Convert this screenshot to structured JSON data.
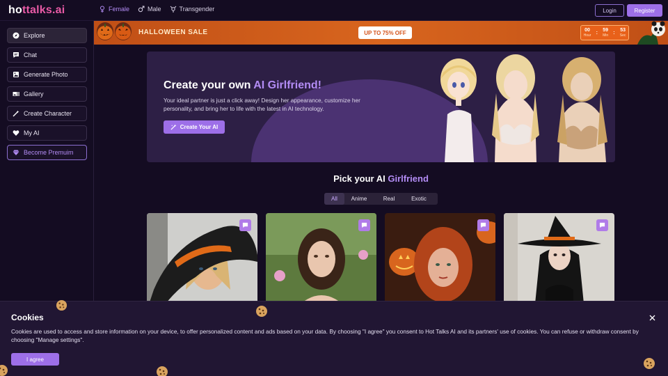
{
  "logo": {
    "part1": "ho",
    "part2": "ttalks.ai"
  },
  "gender_nav": [
    {
      "label": "Female",
      "icon": "female-icon"
    },
    {
      "label": "Male",
      "icon": "male-icon"
    },
    {
      "label": "Transgender",
      "icon": "transgender-icon"
    }
  ],
  "auth": {
    "login": "Login",
    "register": "Register"
  },
  "sidebar": {
    "items": [
      {
        "label": "Explore",
        "icon": "compass-icon"
      },
      {
        "label": "Chat",
        "icon": "chat-icon"
      },
      {
        "label": "Generate Photo",
        "icon": "image-icon"
      },
      {
        "label": "Gallery",
        "icon": "gallery-icon"
      },
      {
        "label": "Create Character",
        "icon": "wand-icon"
      },
      {
        "label": "My AI",
        "icon": "heart-icon"
      },
      {
        "label": "Become Premuim",
        "icon": "diamond-icon"
      }
    ]
  },
  "promo": {
    "title": "HALLOWEEN SALE",
    "button": "UP TO 75% OFF",
    "countdown": {
      "hours": "00",
      "minutes": "59",
      "seconds": "53",
      "hour_label": "Hour",
      "min_label": "Min",
      "sec_label": "Sec"
    }
  },
  "hero": {
    "title_plain": "Create your own ",
    "title_accent": "AI Girlfriend!",
    "description": "Your ideal partner is just a click away! Design her appearance, customize her personality, and bring her to life with the latest in AI technology.",
    "button": "Create Your AI"
  },
  "pick": {
    "title_plain": "Pick your AI ",
    "title_accent": "Girlfriend",
    "filters": [
      "All",
      "Anime",
      "Real",
      "Exotic"
    ],
    "active_filter": "All"
  },
  "cookie": {
    "title": "Cookies",
    "text": "Cookies are used to access and store information on your device, to offer personalized content and ads based on your data. By choosing \"I agree\" you consent to Hot Talks AI and its partners' use of cookies. You can refuse or withdraw consent by choosing \"Manage settings\".",
    "agree": "I agree"
  },
  "colors": {
    "accent": "#9d6fe8",
    "accent_text": "#b38cf5",
    "background": "#140c22",
    "promo_orange": "#d8651e"
  }
}
